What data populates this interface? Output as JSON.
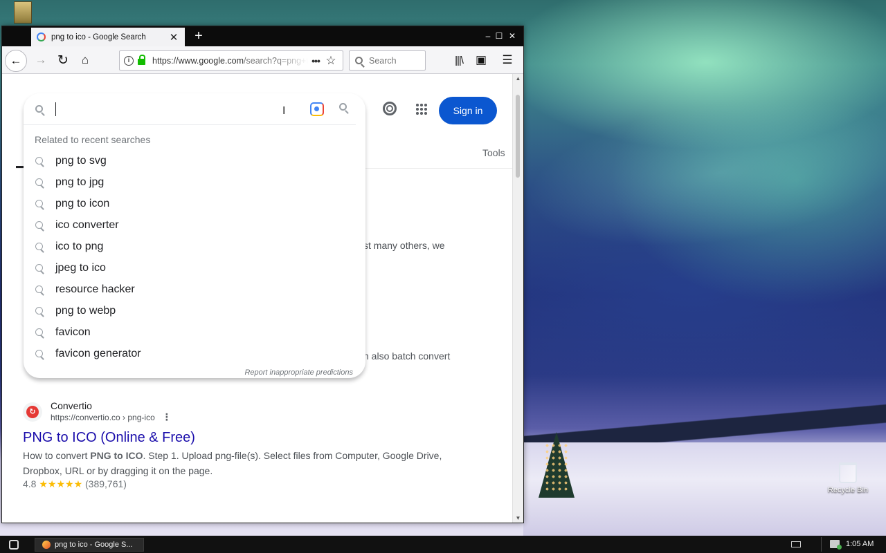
{
  "desktop": {
    "recycle_bin_label": "Recycle Bin"
  },
  "browser": {
    "tab_title": "png to ico - Google Search",
    "tab_close": "✕",
    "new_tab": "+",
    "window_controls": {
      "minimize": "‒",
      "maximize": "☐",
      "close": "✕"
    },
    "toolbar": {
      "url_host": "https://www.google.com",
      "url_path": "/search?q=png+to+ico",
      "page_actions": "•••",
      "search_placeholder": "Search"
    }
  },
  "google": {
    "sign_in_label": "Sign in",
    "tools_label": "Tools",
    "search_input_value": "",
    "suggestions_header": "Related to recent searches",
    "suggestions": [
      "png to svg",
      "png to jpg",
      "png to icon",
      "ico converter",
      "ico to png",
      "jpeg to ico",
      "resource hacker",
      "png to webp",
      "favicon",
      "favicon generator"
    ],
    "report_link": "Report inappropriate predictions",
    "snippet_fragment_1": "st many others, we",
    "snippet_fragment_2": "n also batch convert",
    "result": {
      "site_name": "Convertio",
      "site_url": "https://convertio.co › png-ico",
      "title": "PNG to ICO (Online & Free)",
      "desc_prefix": "How to convert ",
      "desc_bold": "PNG to ICO",
      "desc_rest": ". Step 1. Upload png-file(s). Select files from Computer, Google Drive,",
      "desc_line2": "Dropbox, URL or by dragging it on the page.",
      "rating_value": "4.8",
      "rating_stars": "★★★★★",
      "rating_count": "(389,761)"
    }
  },
  "taskbar": {
    "task_label": "png to ico - Google S...",
    "clock": "1:05 AM"
  },
  "colors": {
    "google_blue_button": "#0b57d0",
    "link_blue": "#1a0dab",
    "star_yellow": "#fbbc04",
    "lock_green": "#12bc00"
  }
}
